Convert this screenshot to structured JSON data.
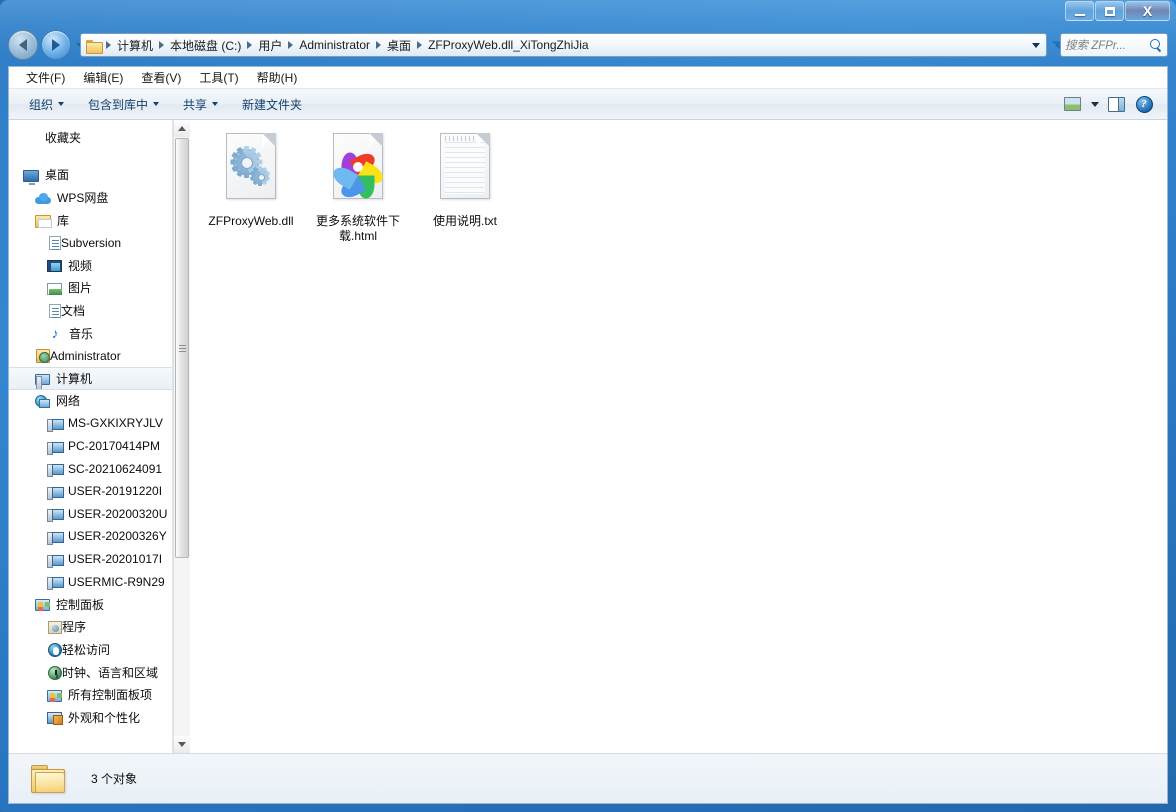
{
  "window": {
    "title": "",
    "buttons": {
      "minimize": "–",
      "maximize": "□",
      "close": "X"
    }
  },
  "navigation": {
    "back_tooltip": "后退",
    "forward_tooltip": "前进",
    "recent_dropdown": "最近的位置"
  },
  "address": {
    "crumbs": [
      "计算机",
      "本地磁盘 (C:)",
      "用户",
      "Administrator",
      "桌面",
      "ZFProxyWeb.dll_XiTongZhiJia"
    ],
    "refresh": "↻"
  },
  "search": {
    "placeholder": "搜索 ZFPr...",
    "value": ""
  },
  "menubar": {
    "items": [
      "文件(F)",
      "编辑(E)",
      "查看(V)",
      "工具(T)",
      "帮助(H)"
    ]
  },
  "toolbar": {
    "items": [
      {
        "label": "组织",
        "caret": true
      },
      {
        "label": "包含到库中",
        "caret": true
      },
      {
        "label": "共享",
        "caret": true
      },
      {
        "label": "新建文件夹",
        "caret": false
      }
    ],
    "right_icons": [
      "views-icon",
      "views-caret-icon",
      "preview-pane-icon",
      "help-icon"
    ]
  },
  "navpane": {
    "items": [
      {
        "label": "收藏夹",
        "icon": "ic-star",
        "indent": 0,
        "selected": false,
        "spacer_after": true
      },
      {
        "label": "桌面",
        "icon": "ic-desktop",
        "indent": 0,
        "selected": false
      },
      {
        "label": "WPS网盘",
        "icon": "ic-cloud",
        "indent": 1,
        "selected": false
      },
      {
        "label": "库",
        "icon": "ic-library",
        "indent": 1,
        "selected": false
      },
      {
        "label": "Subversion",
        "icon": "ic-doc",
        "indent": 2,
        "selected": false
      },
      {
        "label": "视频",
        "icon": "ic-video",
        "indent": 2,
        "selected": false
      },
      {
        "label": "图片",
        "icon": "ic-picture",
        "indent": 2,
        "selected": false
      },
      {
        "label": "文档",
        "icon": "ic-doc",
        "indent": 2,
        "selected": false
      },
      {
        "label": "音乐",
        "icon": "ic-music",
        "indent": 2,
        "selected": false,
        "glyph": "♪"
      },
      {
        "label": "Administrator",
        "icon": "ic-user",
        "indent": 1,
        "selected": false
      },
      {
        "label": "计算机",
        "icon": "ic-computer",
        "indent": 1,
        "selected": true
      },
      {
        "label": "网络",
        "icon": "ic-network",
        "indent": 1,
        "selected": false
      },
      {
        "label": "MS-GXKIXRYJLV",
        "icon": "ic-pc",
        "indent": 2,
        "selected": false
      },
      {
        "label": "PC-20170414PM",
        "icon": "ic-pc",
        "indent": 2,
        "selected": false
      },
      {
        "label": "SC-20210624091",
        "icon": "ic-pc",
        "indent": 2,
        "selected": false
      },
      {
        "label": "USER-20191220I",
        "icon": "ic-pc",
        "indent": 2,
        "selected": false
      },
      {
        "label": "USER-20200320U",
        "icon": "ic-pc",
        "indent": 2,
        "selected": false
      },
      {
        "label": "USER-20200326Y",
        "icon": "ic-pc",
        "indent": 2,
        "selected": false
      },
      {
        "label": "USER-20201017I",
        "icon": "ic-pc",
        "indent": 2,
        "selected": false
      },
      {
        "label": "USERMIC-R9N29",
        "icon": "ic-pc",
        "indent": 2,
        "selected": false
      },
      {
        "label": "控制面板",
        "icon": "ic-ctrlpanel",
        "indent": 1,
        "selected": false
      },
      {
        "label": "程序",
        "icon": "ic-programs",
        "indent": 2,
        "selected": false
      },
      {
        "label": "轻松访问",
        "icon": "ic-ease",
        "indent": 2,
        "selected": false
      },
      {
        "label": "时钟、语言和区域",
        "icon": "ic-clock",
        "indent": 2,
        "selected": false
      },
      {
        "label": "所有控制面板项",
        "icon": "ic-ctrlpanel",
        "indent": 2,
        "selected": false
      },
      {
        "label": "外观和个性化",
        "icon": "ic-appearance",
        "indent": 2,
        "selected": false
      }
    ]
  },
  "files": [
    {
      "name": "ZFProxyWeb.dll",
      "type": "dll"
    },
    {
      "name": "更多系统软件下载.html",
      "type": "html"
    },
    {
      "name": "使用说明.txt",
      "type": "txt"
    }
  ],
  "statusbar": {
    "text": "3 个对象"
  },
  "colors": {
    "frame": "#2b86d4",
    "accent": "#14416b",
    "selection": "#cde8ff",
    "pinwheel_purple": "#a43fd6",
    "pinwheel_red": "#ef3b2a",
    "pinwheel_yellow": "#fbe216",
    "pinwheel_green": "#32bf5e",
    "pinwheel_blue": "#4b96e6"
  }
}
